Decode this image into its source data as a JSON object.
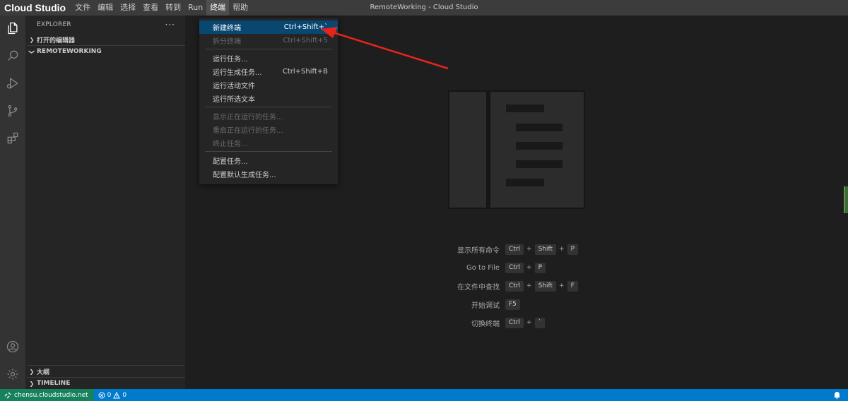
{
  "app": {
    "brand": "Cloud Studio",
    "window_title": "RemoteWorking - Cloud Studio"
  },
  "menubar": [
    {
      "label": "文件"
    },
    {
      "label": "编辑"
    },
    {
      "label": "选择"
    },
    {
      "label": "查看"
    },
    {
      "label": "转到"
    },
    {
      "label": "Run"
    },
    {
      "label": "终端",
      "active": true
    },
    {
      "label": "帮助"
    }
  ],
  "activitybar": {
    "top": [
      "explorer-icon",
      "search-icon",
      "run-debug-icon",
      "source-control-icon",
      "extensions-icon"
    ],
    "bottom": [
      "account-icon",
      "settings-gear-icon"
    ]
  },
  "sidebar": {
    "header": "EXPLORER",
    "more": "···",
    "sections": [
      {
        "label": "打开的编辑器",
        "expanded": false
      },
      {
        "label": "REMOTEWORKING",
        "expanded": true
      }
    ],
    "bottom_sections": [
      {
        "label": "大纲"
      },
      {
        "label": "TIMELINE"
      }
    ]
  },
  "terminal_menu": {
    "groups": [
      [
        {
          "label": "新建终端",
          "shortcut": "Ctrl+Shift+`",
          "state": "selected"
        },
        {
          "label": "拆分终端",
          "shortcut": "Ctrl+Shift+5",
          "state": "disabled"
        }
      ],
      [
        {
          "label": "运行任务...",
          "shortcut": "",
          "state": "normal"
        },
        {
          "label": "运行生成任务...",
          "shortcut": "Ctrl+Shift+B",
          "state": "normal"
        },
        {
          "label": "运行活动文件",
          "shortcut": "",
          "state": "normal"
        },
        {
          "label": "运行所选文本",
          "shortcut": "",
          "state": "normal"
        }
      ],
      [
        {
          "label": "显示正在运行的任务...",
          "shortcut": "",
          "state": "disabled"
        },
        {
          "label": "重启正在运行的任务...",
          "shortcut": "",
          "state": "disabled"
        },
        {
          "label": "终止任务...",
          "shortcut": "",
          "state": "disabled"
        }
      ],
      [
        {
          "label": "配置任务...",
          "shortcut": "",
          "state": "normal"
        },
        {
          "label": "配置默认生成任务...",
          "shortcut": "",
          "state": "normal"
        }
      ]
    ]
  },
  "welcome_shortcuts": [
    {
      "label": "显示所有命令",
      "keys": [
        "Ctrl",
        "Shift",
        "P"
      ]
    },
    {
      "label": "Go to File",
      "keys": [
        "Ctrl",
        "P"
      ]
    },
    {
      "label": "在文件中查找",
      "keys": [
        "Ctrl",
        "Shift",
        "F"
      ]
    },
    {
      "label": "开始调试",
      "keys": [
        "F5"
      ]
    },
    {
      "label": "切换终端",
      "keys": [
        "Ctrl",
        "`"
      ]
    }
  ],
  "statusbar": {
    "remote": "chensu.cloudstudio.net",
    "errors": "0",
    "warnings": "0"
  },
  "colors": {
    "accent": "#007acc",
    "remote": "#16825d",
    "menu_selected": "#094771",
    "annotation_arrow": "#e8231c"
  }
}
